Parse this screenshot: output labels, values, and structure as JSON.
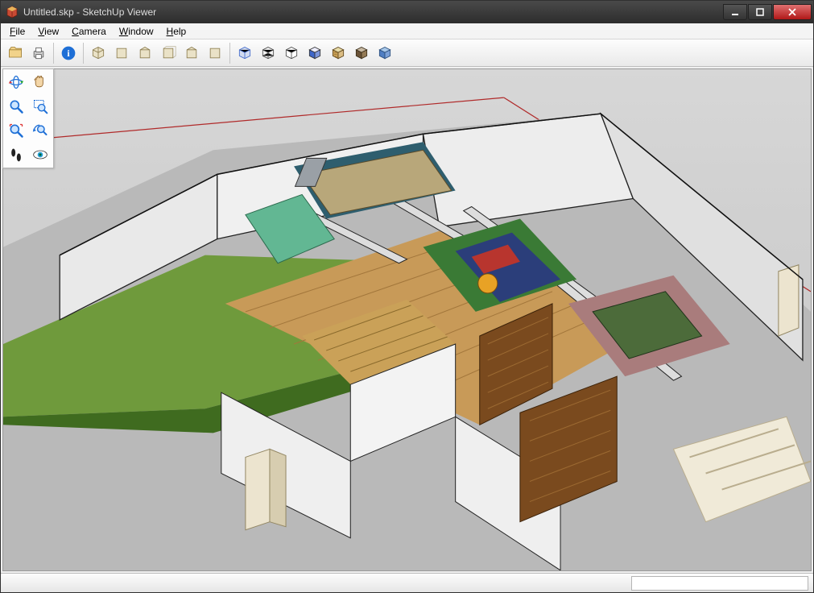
{
  "window": {
    "title": "Untitled.skp - SketchUp Viewer"
  },
  "menu": {
    "items": [
      {
        "label": "File",
        "accel": "F"
      },
      {
        "label": "View",
        "accel": "V"
      },
      {
        "label": "Camera",
        "accel": "C"
      },
      {
        "label": "Window",
        "accel": "W"
      },
      {
        "label": "Help",
        "accel": "H"
      }
    ]
  },
  "toolbar_main": {
    "file_group": [
      "open-icon",
      "print-icon"
    ],
    "info_group": [
      "model-info-icon"
    ],
    "view_group": [
      "iso-icon",
      "top-icon",
      "front-icon",
      "right-icon",
      "back-icon",
      "left-icon"
    ],
    "style_group": [
      "xray-icon",
      "wireframe-icon",
      "hidden-line-icon",
      "shaded-icon",
      "shaded-textures-icon",
      "monochrome-icon",
      "color-by-layer-icon"
    ]
  },
  "palette": {
    "tools": [
      "orbit-icon",
      "pan-icon",
      "zoom-icon",
      "zoom-window-icon",
      "zoom-extents-icon",
      "previous-icon",
      "walk-icon",
      "look-around-icon"
    ]
  },
  "statusbar": {
    "field_value": ""
  },
  "colors": {
    "info_blue": "#1e6fd6",
    "cube_shaded": "#3f67c9",
    "cube_tex": "#caa158",
    "cube_mono": "#7a5c3b"
  }
}
